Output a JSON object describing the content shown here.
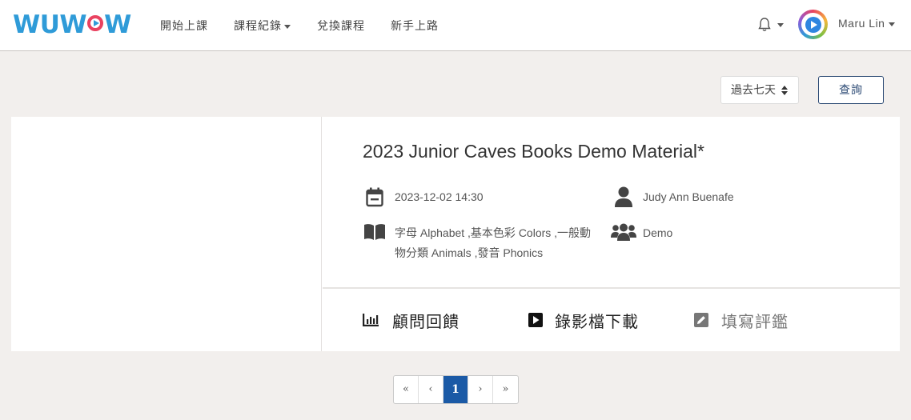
{
  "brand": {
    "logo_left": "WUW",
    "logo_right": "W",
    "colors": {
      "logo": "#2f9bd8",
      "accent": "#e94260"
    }
  },
  "nav": {
    "items": [
      {
        "label": "開始上課",
        "dropdown": false
      },
      {
        "label": "課程紀錄",
        "dropdown": true
      },
      {
        "label": "兌換課程",
        "dropdown": false
      },
      {
        "label": "新手上路",
        "dropdown": false
      }
    ],
    "bell_icon": "bell-icon",
    "user_name": "Maru Lin"
  },
  "filters": {
    "period_selected": "過去七天",
    "query_label": "查詢",
    "colors": {
      "query_border": "#2c4a74"
    }
  },
  "session": {
    "title": "2023 Junior Caves Books Demo Material*",
    "datetime": "2023-12-02 14:30",
    "consultant": "Judy Ann Buenafe",
    "topics_line1": "字母 Alphabet ,基本色彩 Colors ,一般動",
    "topics_line2": "物分類 Animals ,發音 Phonics",
    "class_type": "Demo",
    "actions": {
      "feedback": "顧問回饋",
      "recording": "錄影檔下載",
      "evaluation": "填寫評鑑"
    }
  },
  "pagination": {
    "first": "«",
    "prev": "‹",
    "current": "1",
    "next": "›",
    "last": "»",
    "colors": {
      "active": "#1b5aa6"
    }
  }
}
